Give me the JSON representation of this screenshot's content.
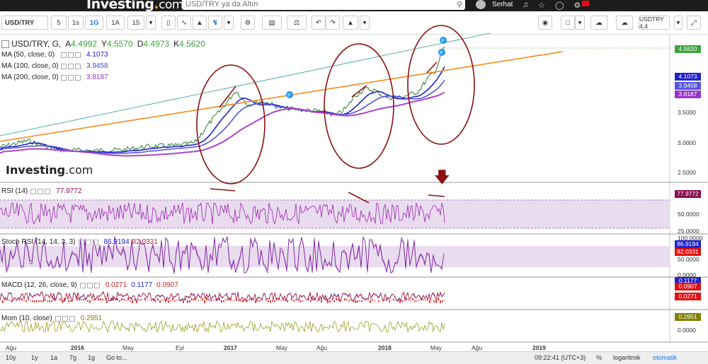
{
  "topbar": {
    "logo_main": "Investing",
    "logo_com": "com",
    "search_placeholder": "USD/TRY ya da Altın",
    "username": "Serhat",
    "icons": [
      "bell-icon",
      "star-icon",
      "clock-icon",
      "settings-icon"
    ],
    "flag_color": "#e30a17"
  },
  "toolbar": {
    "symbol": "USD/TRY",
    "intervals": [
      "5",
      "1s",
      "1G",
      "1A",
      "15"
    ],
    "active_interval": "1G",
    "symbol_right": "USDTRY 4,4"
  },
  "legend": {
    "title": "USD/TRY, G,",
    "ohlc": {
      "o_label": "A",
      "o": "4.4992",
      "h_label": "Y",
      "h": "4.5570",
      "l_label": "D",
      "l": "4.4973",
      "c_label": "K",
      "c": "4.5620"
    },
    "ma": [
      {
        "label": "MA (50, close, 0)",
        "value": "4.1073",
        "color": "#2222cc"
      },
      {
        "label": "MA (100, close, 0)",
        "value": "3.9458",
        "color": "#4444dd"
      },
      {
        "label": "MA (200, close, 0)",
        "value": "3.8187",
        "color": "#9933cc"
      }
    ]
  },
  "price_axis": {
    "ticks": [
      "3.5000",
      "3.0000",
      "2.5000"
    ],
    "boxes": {
      "last": "4.5620",
      "ma50": "4.1073",
      "ma100": "3.9458",
      "ma200": "3.8187"
    },
    "colors": {
      "last": "#3fa33f",
      "ma50": "#2222cc",
      "ma100": "#5555dd",
      "ma200": "#9933cc"
    }
  },
  "watermark": {
    "main": "Investing",
    "com": ".com"
  },
  "rsi": {
    "label": "RSI (14)",
    "value": "77.9772",
    "ticks": [
      "50.0000",
      "25.0000"
    ],
    "box": "77.9772",
    "color": "#880e4f"
  },
  "stoch": {
    "label": "Stoch RSI (14, 14, 3, 3)",
    "k": "86.9194",
    "d": "82.0331",
    "ticks": [
      "100.0000",
      "50.0000",
      "0.0000"
    ],
    "box_k": "86.9194",
    "box_d": "82.0331"
  },
  "macd": {
    "label": "MACD (12, 26, close, 9)",
    "hist": "0.0271",
    "macd": "0.1177",
    "signal": "0.0907",
    "box_macd": "0.1177",
    "box_signal": "0.0907",
    "box_hist": "0.0271"
  },
  "mom": {
    "label": "Mom (10, close)",
    "value": "0.2951",
    "tick": "0.0000",
    "box": "0.2951"
  },
  "xaxis": [
    {
      "label": "Ağu",
      "bold": false
    },
    {
      "label": "2016",
      "bold": true
    },
    {
      "label": "May",
      "bold": false
    },
    {
      "label": "Eyl",
      "bold": false
    },
    {
      "label": "2017",
      "bold": true
    },
    {
      "label": "May",
      "bold": false
    },
    {
      "label": "Ağu",
      "bold": false
    },
    {
      "label": "2018",
      "bold": true
    },
    {
      "label": "May",
      "bold": false
    },
    {
      "label": "Ağu",
      "bold": false
    },
    {
      "label": "2019",
      "bold": true
    }
  ],
  "bottombar": {
    "ranges": [
      "10y",
      "1y",
      "1a",
      "7g",
      "1g",
      "Go to..."
    ],
    "time": "09:22:41 (UTC+3)",
    "percent": "%",
    "log": "logaritmik",
    "auto": "otomatik"
  }
}
